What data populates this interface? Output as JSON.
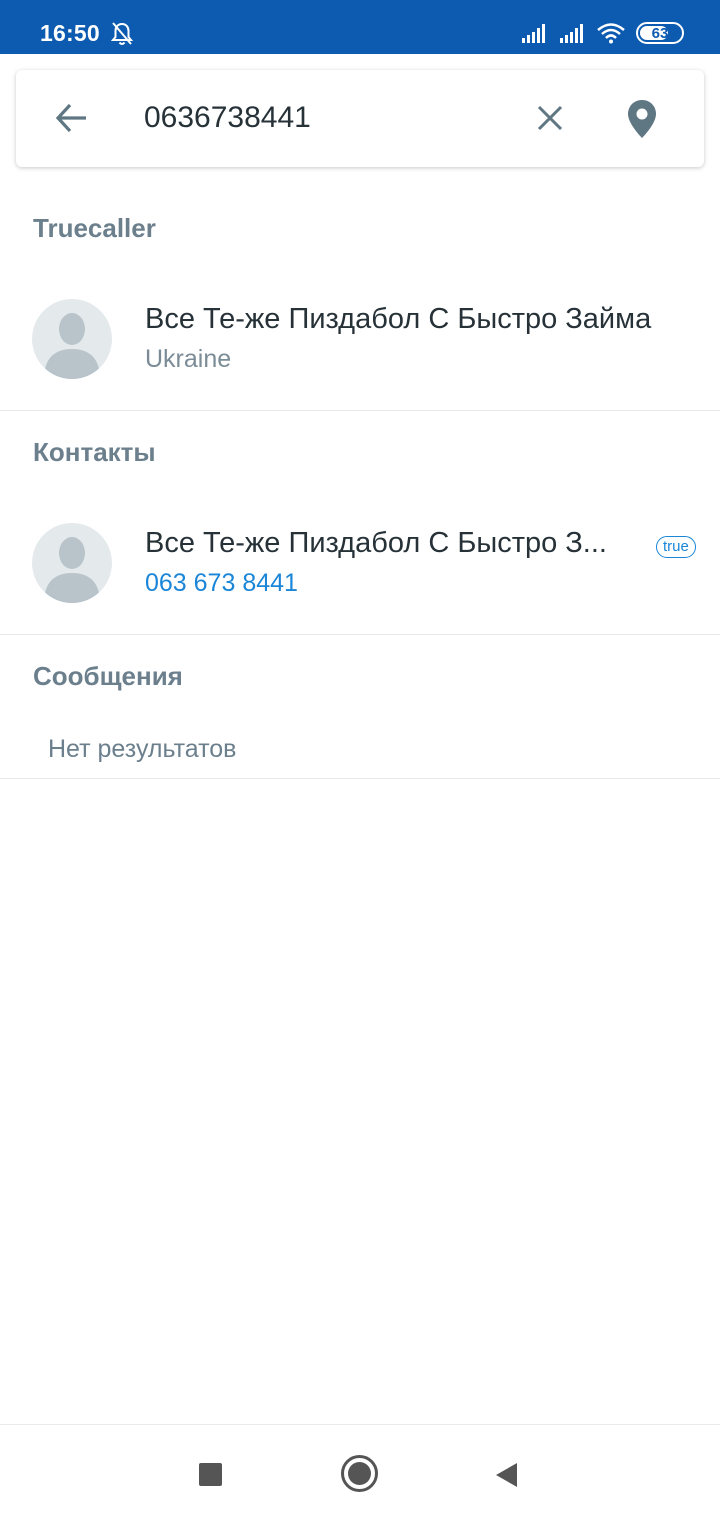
{
  "status_bar": {
    "time": "16:50",
    "battery": "63",
    "battery_level": 0.63,
    "icons": [
      "bell-off-icon",
      "signal-icon",
      "signal-icon",
      "wifi-icon",
      "battery-icon"
    ],
    "background": "#0d5bb1"
  },
  "search": {
    "value": "0636738441",
    "back_icon": "arrow-left-icon",
    "clear_icon": "close-icon",
    "location_icon": "location-pin-icon"
  },
  "sections": {
    "truecaller": {
      "header": "Truecaller",
      "item": {
        "name": "Все Те-же Пиздабол С Быстро Займа",
        "subtitle": "Ukraine"
      }
    },
    "contacts": {
      "header": "Контакты",
      "item": {
        "name": "Все Те-же Пиздабол С Быстро З...",
        "phone": "063 673 8441",
        "badge": "true"
      }
    },
    "messages": {
      "header": "Сообщения",
      "empty_text": "Нет результатов"
    }
  },
  "nav_bar": {
    "icons": [
      "recent-apps-icon",
      "home-icon",
      "back-icon"
    ]
  },
  "colors": {
    "accent": "#1b86d8",
    "section_header": "#6b7f8c",
    "text_primary": "#263238"
  }
}
